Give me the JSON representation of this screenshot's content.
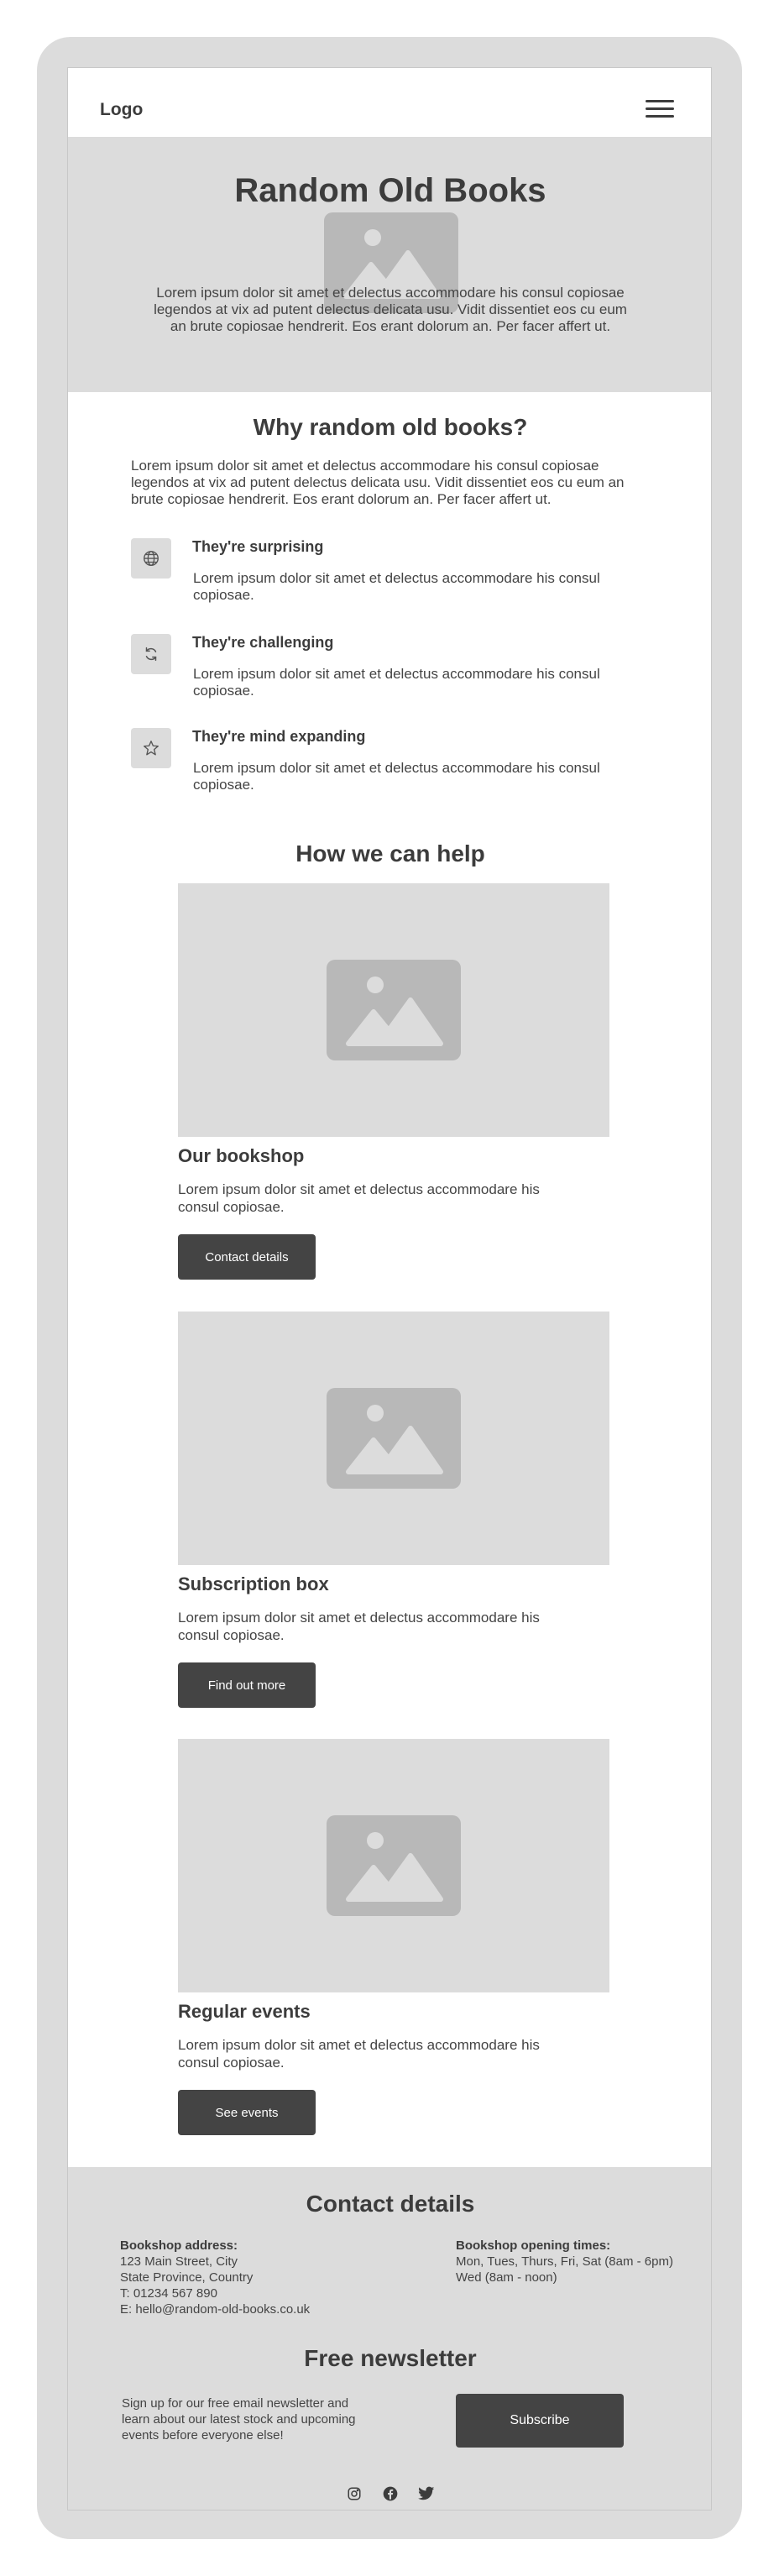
{
  "header": {
    "logo": "Logo",
    "menu_icon": "hamburger-menu-icon"
  },
  "hero": {
    "title": "Random Old Books",
    "image_icon": "image-placeholder-icon",
    "text": "Lorem ipsum dolor sit amet et delectus accommodare his consul copiosae legendos at vix ad putent delectus delicata usu. Vidit dissentiet eos cu eum an brute copiosae hendrerit. Eos erant dolorum an. Per facer affert ut."
  },
  "why": {
    "title": "Why random old books?",
    "intro": "Lorem ipsum dolor sit amet et delectus accommodare his consul copiosae legendos at vix ad putent delectus delicata usu. Vidit dissentiet eos cu eum an brute copiosae hendrerit. Eos erant dolorum an. Per facer affert ut.",
    "features": [
      {
        "icon": "globe-icon",
        "title": "They're surprising",
        "text": "Lorem ipsum dolor sit amet et delectus accommodare his consul copiosae."
      },
      {
        "icon": "refresh-icon",
        "title": "They're challenging",
        "text": "Lorem ipsum dolor sit amet et delectus accommodare his consul copiosae."
      },
      {
        "icon": "star-icon",
        "title": "They're mind expanding",
        "text": "Lorem ipsum dolor sit amet et delectus accommodare his consul copiosae."
      }
    ]
  },
  "help": {
    "title": "How we can help",
    "cards": [
      {
        "title": "Our bookshop",
        "text": "Lorem ipsum dolor sit amet et delectus accommodare his consul copiosae.",
        "button": "Contact details"
      },
      {
        "title": "Subscription box",
        "text": "Lorem ipsum dolor sit amet et delectus accommodare his consul copiosae.",
        "button": "Find out more"
      },
      {
        "title": "Regular events",
        "text": "Lorem ipsum dolor sit amet et delectus accommodare his consul copiosae.",
        "button": "See events"
      }
    ]
  },
  "contact": {
    "title": "Contact details",
    "address_label": "Bookshop address:",
    "address_lines": [
      "123 Main Street, City",
      "State Province, Country",
      "T: 01234 567 890",
      "E: hello@random-old-books.co.uk"
    ],
    "hours_label": "Bookshop opening times:",
    "hours_lines": [
      "Mon, Tues, Thurs, Fri, Sat (8am - 6pm)",
      "Wed (8am - noon)"
    ]
  },
  "newsletter": {
    "title": "Free newsletter",
    "text": "Sign up for our free email newsletter and learn about our latest stock and upcoming events before everyone else!",
    "button": "Subscribe"
  },
  "socials": [
    "instagram-icon",
    "facebook-icon",
    "twitter-icon"
  ],
  "colors": {
    "frame": "#dcdcdc",
    "placeholder": "#dcdcdc",
    "placeholder_icon": "#b8b8b8",
    "button": "#444444",
    "text": "#3c3c3c"
  }
}
